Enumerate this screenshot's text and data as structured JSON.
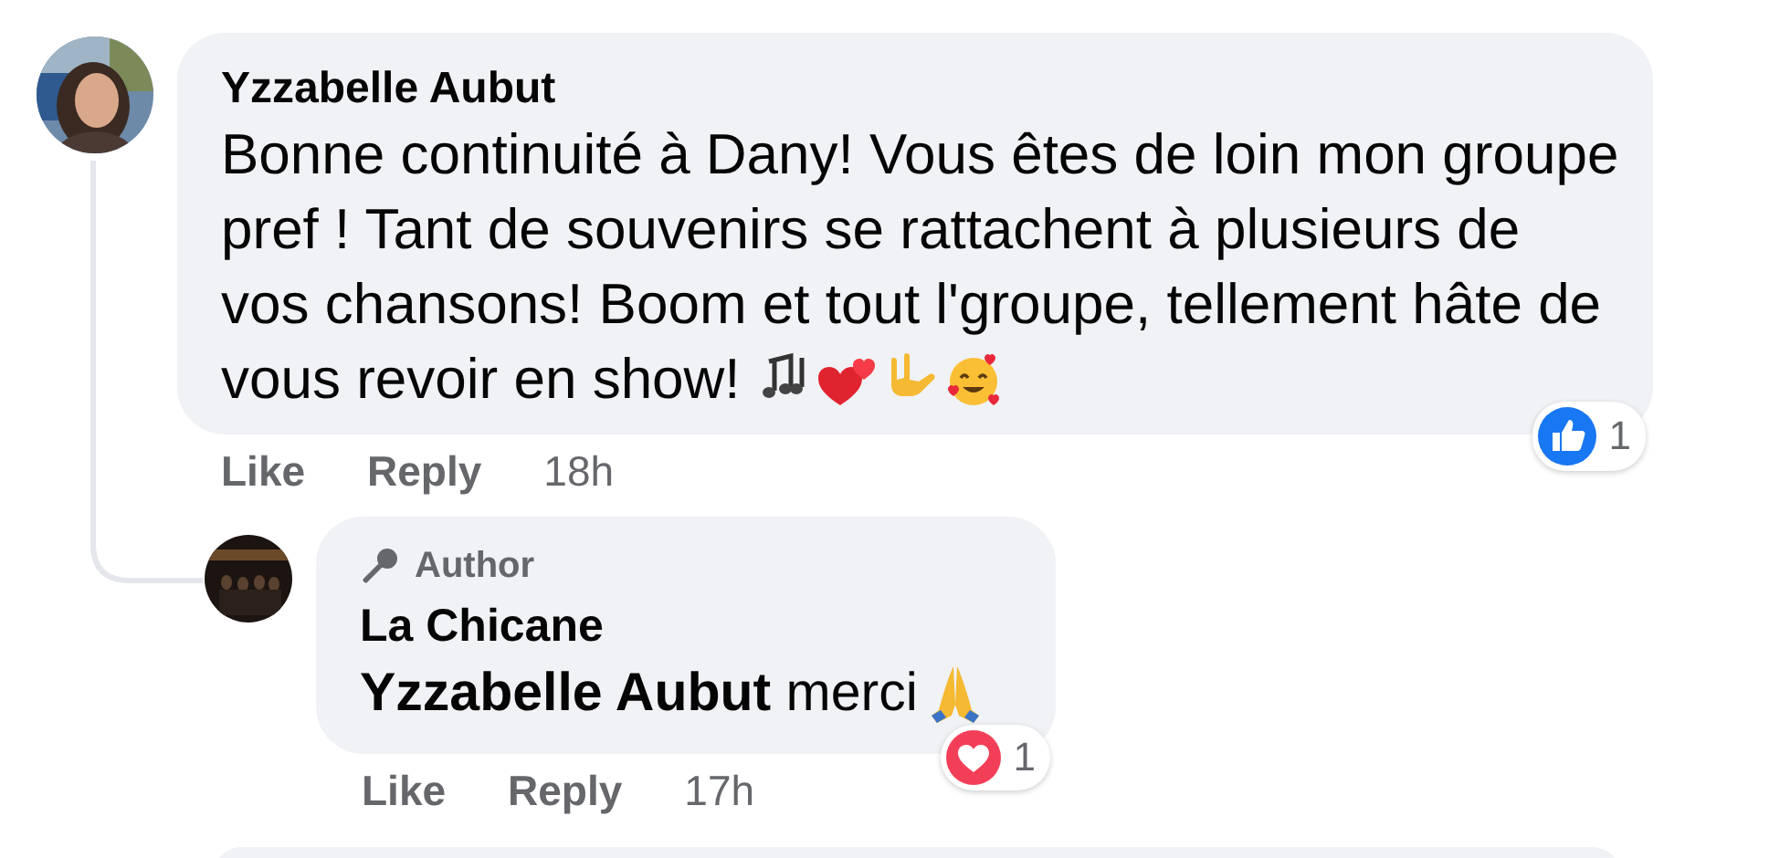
{
  "comment": {
    "author": "Yzzabelle Aubut",
    "text_lines": [
      "Bonne continuité à Dany! Vous êtes de loin mon groupe",
      "pref ! Tant de souvenirs se rattachent à plusieurs de",
      "vos chansons! Boom et tout l'groupe, tellement hâte de",
      "vous revoir en show!"
    ],
    "reaction": {
      "kind": "like",
      "count": "1"
    },
    "actions": [
      "Like",
      "Reply"
    ],
    "time": "18h"
  },
  "reply": {
    "badge": "Author",
    "author": "La Chicane",
    "text": "**Yzzabelle Aubut** merci",
    "reaction": {
      "kind": "love",
      "count": "1"
    },
    "actions": [
      "Like",
      "Reply"
    ],
    "time": "17h"
  }
}
